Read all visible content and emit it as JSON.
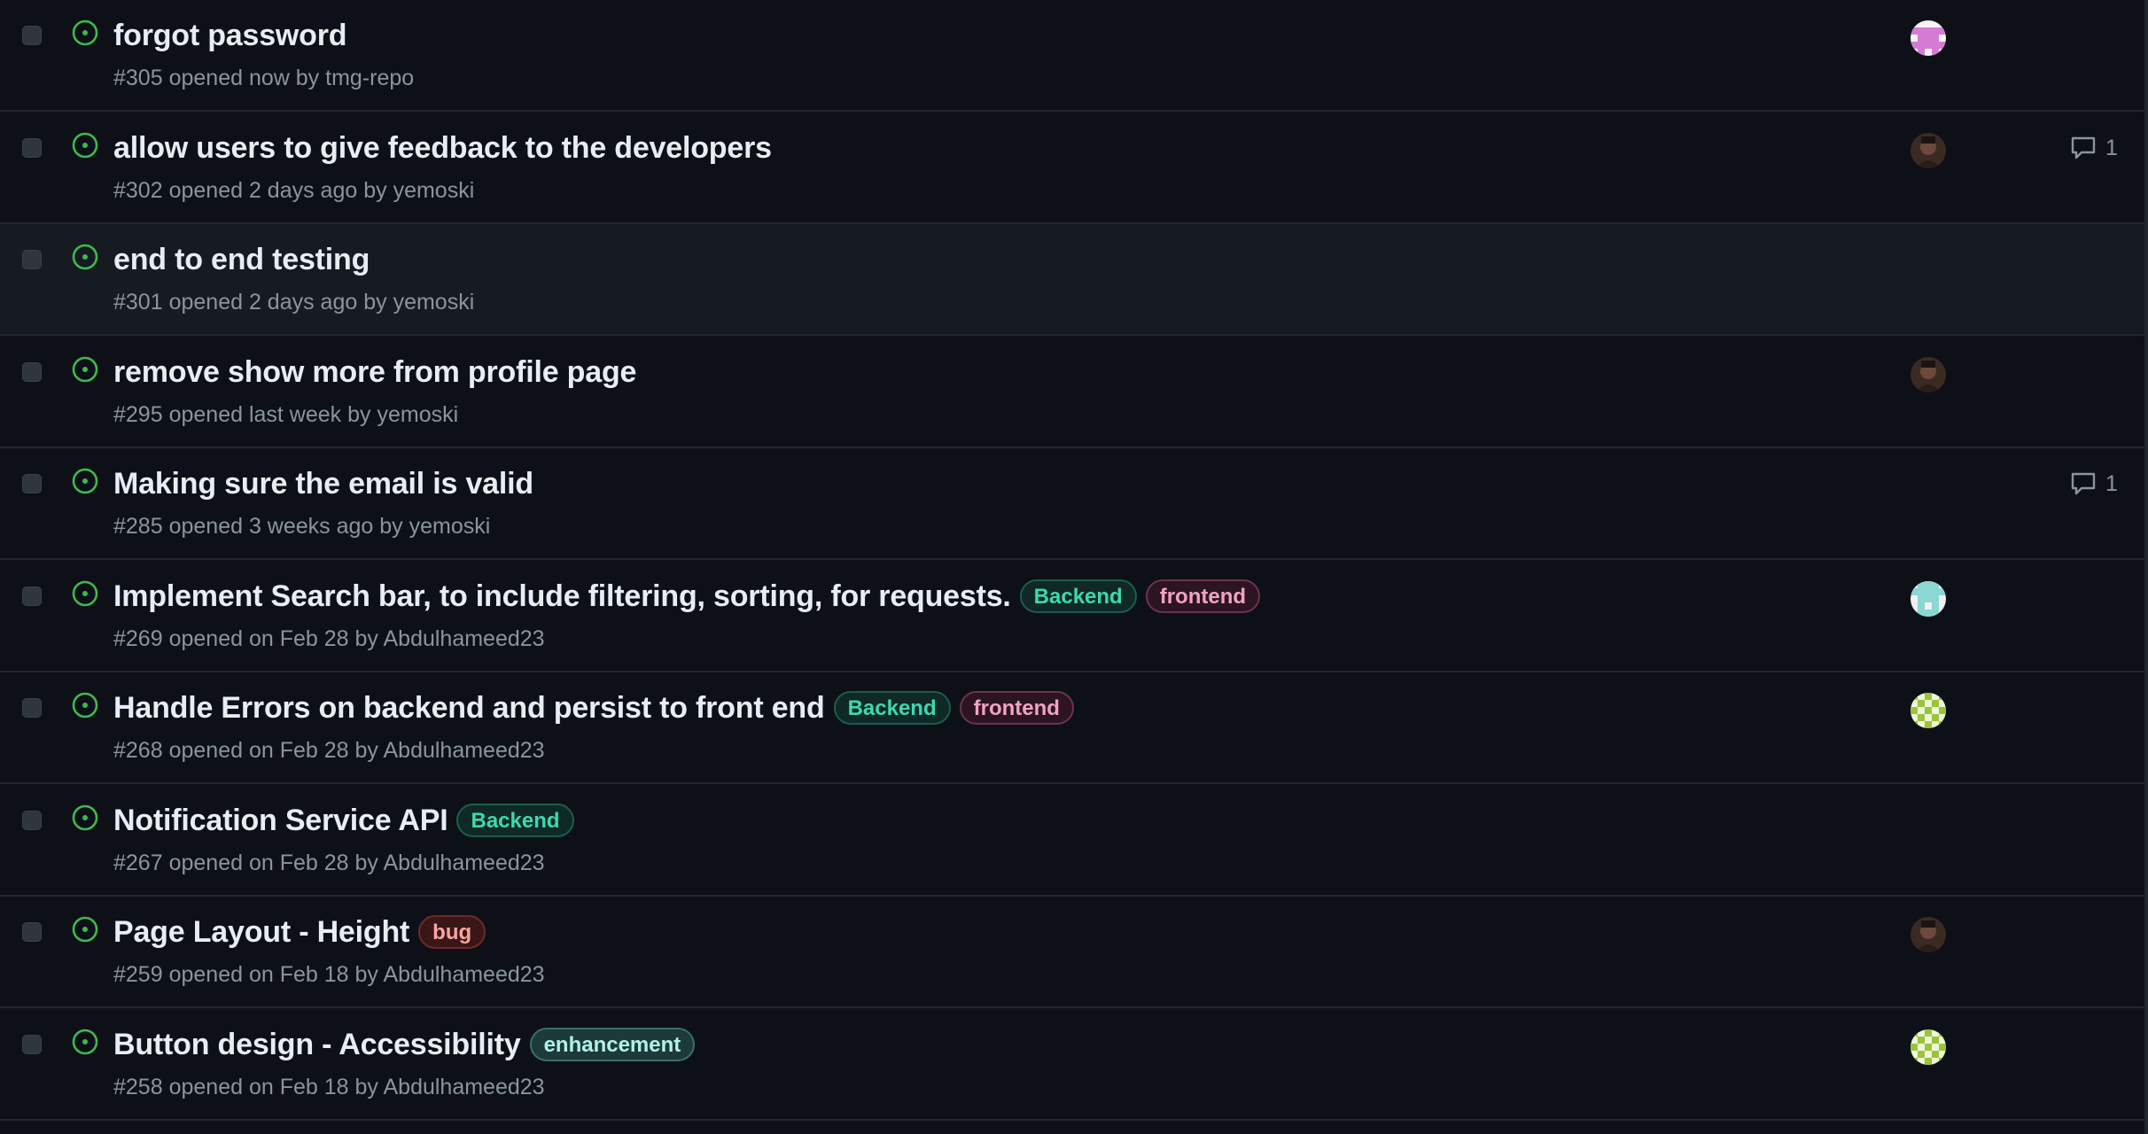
{
  "colors": {
    "background": "#0d1117",
    "row_hover": "#161b22",
    "divider": "#21262d",
    "open_icon": "#3fb950",
    "title": "#e6edf3",
    "meta": "#8b949e"
  },
  "issues": [
    {
      "title": "forgot password",
      "number": "#305",
      "opened_text": "opened now",
      "by": "by",
      "author": "tmg-repo",
      "labels": [],
      "assignee_avatar": "pink-identicon",
      "comments": null,
      "hovered": false
    },
    {
      "title": "allow users to give feedback to the developers",
      "number": "#302",
      "opened_text": "opened 2 days ago",
      "by": "by",
      "author": "yemoski",
      "labels": [],
      "assignee_avatar": "photo-avatar",
      "comments": "1",
      "hovered": false
    },
    {
      "title": "end to end testing",
      "number": "#301",
      "opened_text": "opened 2 days ago",
      "by": "by",
      "author": "yemoski",
      "labels": [],
      "assignee_avatar": null,
      "comments": null,
      "hovered": true
    },
    {
      "title": "remove show more from profile page",
      "number": "#295",
      "opened_text": "opened last week",
      "by": "by",
      "author": "yemoski",
      "labels": [],
      "assignee_avatar": "photo-avatar",
      "comments": null,
      "hovered": false
    },
    {
      "title": "Making sure the email is valid",
      "number": "#285",
      "opened_text": "opened 3 weeks ago",
      "by": "by",
      "author": "yemoski",
      "labels": [],
      "assignee_avatar": null,
      "comments": "1",
      "hovered": false
    },
    {
      "title": "Implement Search bar, to include filtering, sorting, for requests.",
      "number": "#269",
      "opened_text": "opened on Feb 28",
      "by": "by",
      "author": "Abdulhameed23",
      "labels": [
        {
          "name": "Backend",
          "color": "#3ed8b0",
          "bg": "#0f2a26",
          "border": "#1d5c4e"
        },
        {
          "name": "frontend",
          "color": "#f0a3c4",
          "bg": "#2d1422",
          "border": "#6b3350"
        }
      ],
      "assignee_avatar": "teal-identicon",
      "comments": null,
      "hovered": false
    },
    {
      "title": "Handle Errors on backend and persist to front end",
      "number": "#268",
      "opened_text": "opened on Feb 28",
      "by": "by",
      "author": "Abdulhameed23",
      "labels": [
        {
          "name": "Backend",
          "color": "#3ed8b0",
          "bg": "#0f2a26",
          "border": "#1d5c4e"
        },
        {
          "name": "frontend",
          "color": "#f0a3c4",
          "bg": "#2d1422",
          "border": "#6b3350"
        }
      ],
      "assignee_avatar": "green-identicon",
      "comments": null,
      "hovered": false
    },
    {
      "title": "Notification Service API",
      "number": "#267",
      "opened_text": "opened on Feb 28",
      "by": "by",
      "author": "Abdulhameed23",
      "labels": [
        {
          "name": "Backend",
          "color": "#3ed8b0",
          "bg": "#0f2a26",
          "border": "#1d5c4e"
        }
      ],
      "assignee_avatar": null,
      "comments": null,
      "hovered": false
    },
    {
      "title": "Page Layout - Height",
      "number": "#259",
      "opened_text": "opened on Feb 18",
      "by": "by",
      "author": "Abdulhameed23",
      "labels": [
        {
          "name": "bug",
          "color": "#f8a5a0",
          "bg": "#3a1617",
          "border": "#6e2a2a"
        }
      ],
      "assignee_avatar": "photo-avatar",
      "comments": null,
      "hovered": false
    },
    {
      "title": "Button design - Accessibility",
      "number": "#258",
      "opened_text": "opened on Feb 18",
      "by": "by",
      "author": "Abdulhameed23",
      "labels": [
        {
          "name": "enhancement",
          "color": "#b4f0ea",
          "bg": "#1c3a38",
          "border": "#3c6d69"
        }
      ],
      "assignee_avatar": "green-identicon",
      "comments": null,
      "hovered": false
    }
  ]
}
